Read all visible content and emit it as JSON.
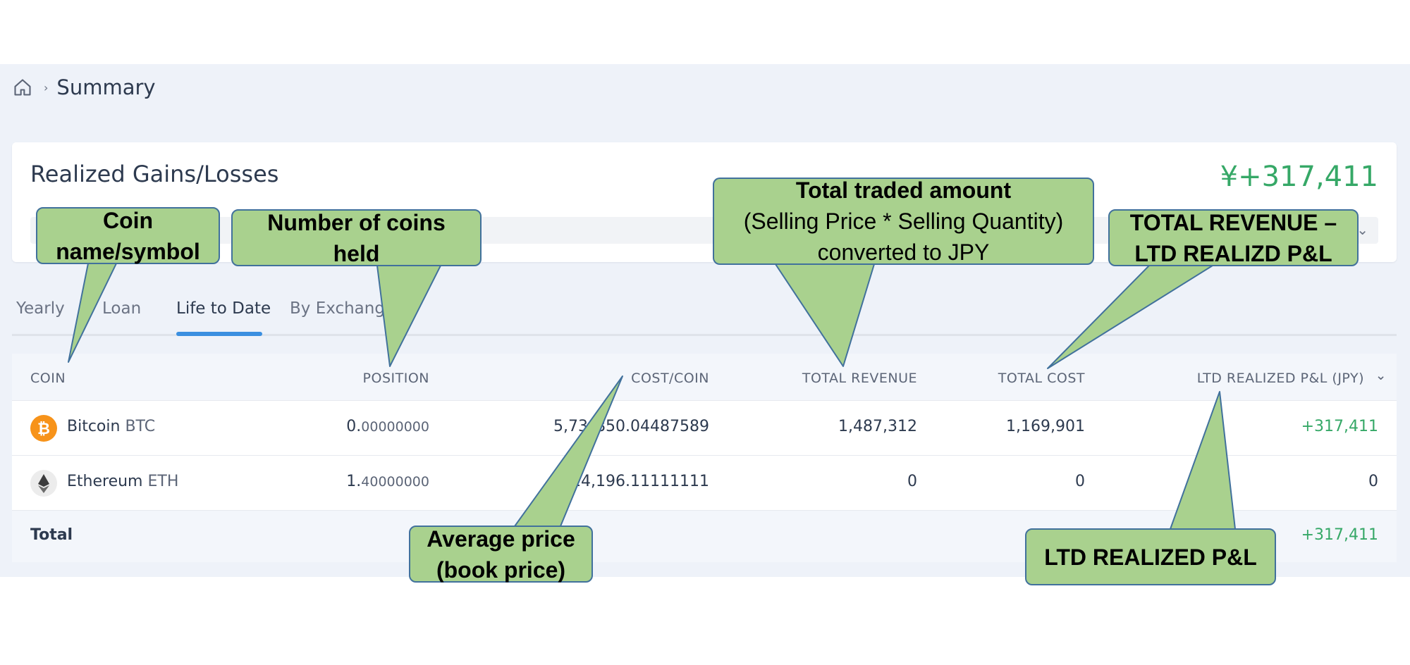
{
  "breadcrumb": {
    "current": "Summary"
  },
  "card": {
    "title": "Realized Gains/Losses",
    "amount": "¥+317,411"
  },
  "tabs": [
    {
      "label": "Yearly"
    },
    {
      "label": "Loan"
    },
    {
      "label": "Life to Date",
      "active": true
    },
    {
      "label": "By Exchange"
    }
  ],
  "table": {
    "headers": {
      "coin": "COIN",
      "position": "POSITION",
      "cost_coin": "COST/COIN",
      "total_revenue": "TOTAL REVENUE",
      "total_cost": "TOTAL COST",
      "ltd_pl": "LTD REALIZED P&L (JPY)"
    },
    "rows": [
      {
        "name": "Bitcoin",
        "symbol": "BTC",
        "position_int": "0.",
        "position_dec": "00000000",
        "cost_coin": "5,73_850.04487589",
        "total_revenue": "1,487,312",
        "total_cost": "1,169,901",
        "ltd_pl": "+317,411"
      },
      {
        "name": "Ethereum",
        "symbol": "ETH",
        "position_int": "1.",
        "position_dec": "40000000",
        "cost_coin": "14,196.11111111",
        "total_revenue": "0",
        "total_cost": "0",
        "ltd_pl": "0"
      }
    ],
    "total": {
      "label": "Total",
      "ltd_pl": "+317,411"
    }
  },
  "callouts": {
    "coin": {
      "l1": "Coin",
      "l2": "name/symbol"
    },
    "position": {
      "l1": "Number of coins",
      "l2": "held"
    },
    "revenue": {
      "l1": "Total traded amount",
      "l2": "(Selling Price * Selling Quantity)",
      "l3": "converted to JPY"
    },
    "cost": {
      "l1": "TOTAL REVENUE –",
      "l2": "LTD REALIZD P&L"
    },
    "avg": {
      "l1": "Average price",
      "l2": "(book price)"
    },
    "pl": {
      "l1": "LTD REALIZED P&L"
    }
  },
  "colors": {
    "accent_green": "#36a867",
    "tab_indicator": "#3b8fe0",
    "callout_fill": "#a9d18e",
    "callout_border": "#41719c",
    "bitcoin": "#f7931a"
  }
}
